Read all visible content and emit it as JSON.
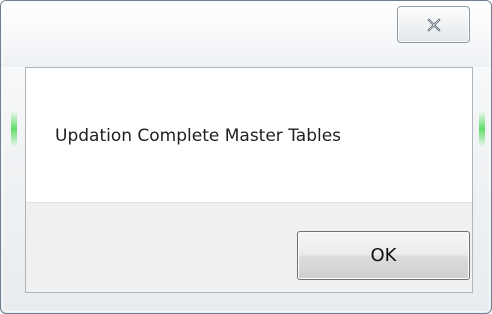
{
  "dialog": {
    "message": "Updation Complete Master Tables",
    "ok_label": "OK",
    "close_icon": "close-icon"
  },
  "colors": {
    "frame_border": "#6f7f90",
    "glow": "#50dc5a",
    "footer": "#f0f0f0"
  }
}
